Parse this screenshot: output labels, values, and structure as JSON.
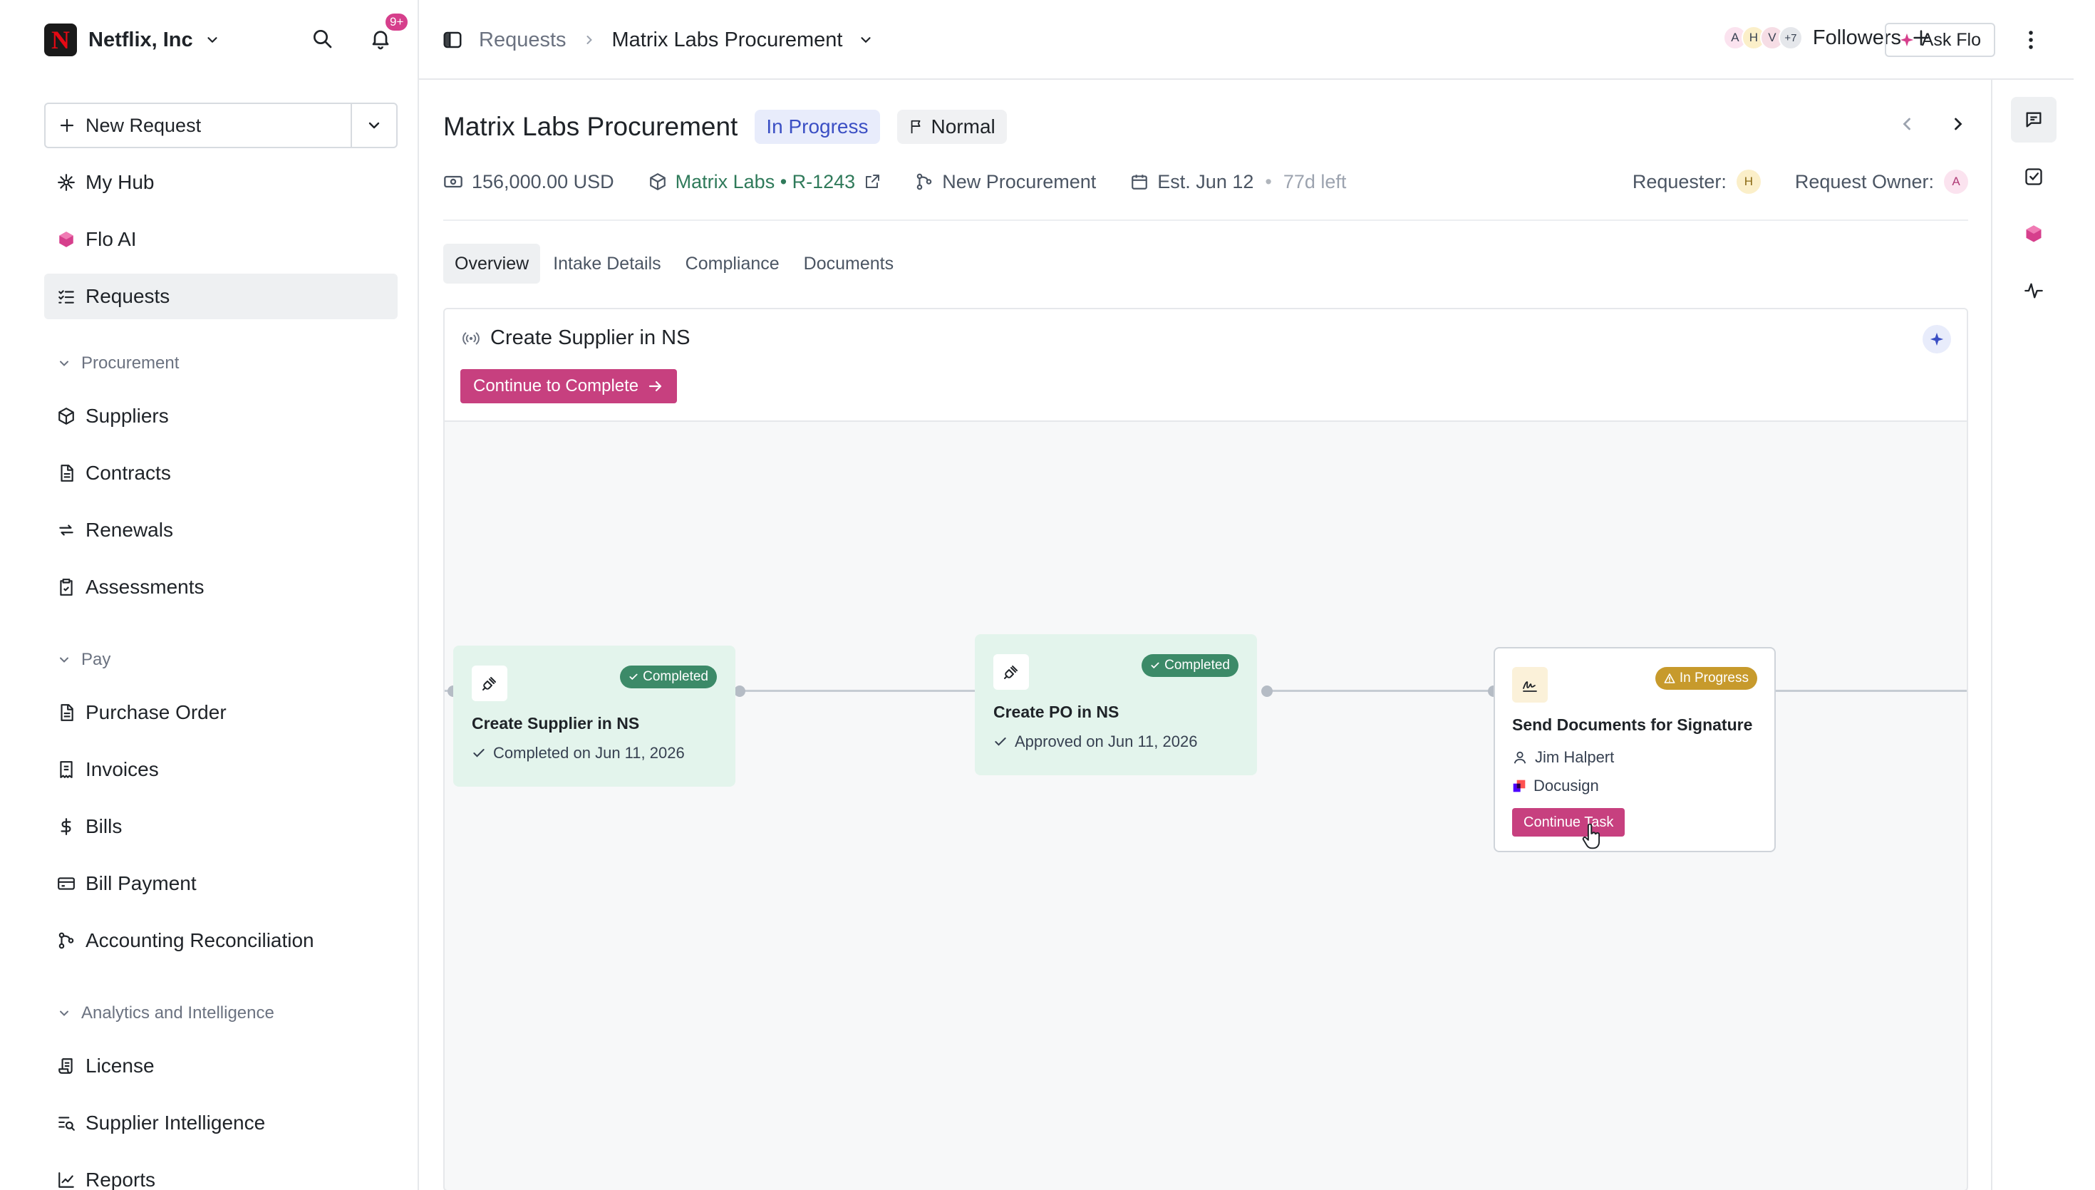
{
  "org": {
    "name": "Netflix, Inc",
    "logo_letter": "N"
  },
  "notifications": {
    "count": "9+"
  },
  "sidebar": {
    "new_request": "New Request",
    "top_items": [
      {
        "label": "My Hub",
        "icon": "hub-icon"
      },
      {
        "label": "Flo AI",
        "icon": "flo-ai-icon"
      },
      {
        "label": "Requests",
        "icon": "list-checks-icon",
        "active": true
      }
    ],
    "sections": [
      {
        "title": "Procurement",
        "items": [
          "Suppliers",
          "Contracts",
          "Renewals",
          "Assessments"
        ]
      },
      {
        "title": "Pay",
        "items": [
          "Purchase Order",
          "Invoices",
          "Bills",
          "Bill Payment",
          "Accounting Reconciliation"
        ]
      },
      {
        "title": "Analytics and Intelligence",
        "items": [
          "License",
          "Supplier Intelligence",
          "Reports"
        ]
      }
    ]
  },
  "header": {
    "breadcrumb_root": "Requests",
    "breadcrumb_current": "Matrix Labs Procurement",
    "followers_label": "Followers",
    "follower_avatars": [
      "A",
      "H",
      "V",
      "+7"
    ],
    "ask_flo": "Ask Flo"
  },
  "request": {
    "title": "Matrix Labs Procurement",
    "status": "In Progress",
    "priority": "Normal",
    "amount": "156,000.00 USD",
    "supplier_link": "Matrix Labs • R-1243",
    "workflow": "New Procurement",
    "estimate": "Est. Jun 12",
    "time_left": "77d left",
    "requester_label": "Requester:",
    "requester_initial": "H",
    "owner_label": "Request Owner:",
    "owner_initial": "A"
  },
  "tabs": [
    "Overview",
    "Intake Details",
    "Compliance",
    "Documents"
  ],
  "current_step": {
    "title": "Create Supplier in NS",
    "continue_label": "Continue to Complete"
  },
  "workflow_nodes": [
    {
      "title": "Create Supplier in NS",
      "status": "Completed",
      "detail": "Completed on Jun 11, 2026"
    },
    {
      "title": "Create PO in NS",
      "status": "Completed",
      "detail": "Approved on Jun 11, 2026"
    },
    {
      "title": "Send Documents for Signature",
      "status": "In Progress",
      "assignee": "Jim Halpert",
      "integration": "Docusign",
      "action": "Continue Task"
    }
  ],
  "colors": {
    "accent": "#c7407f",
    "success": "#3c8a68",
    "warning": "#c79a2c",
    "progress_badge": "#3b4fc4"
  }
}
